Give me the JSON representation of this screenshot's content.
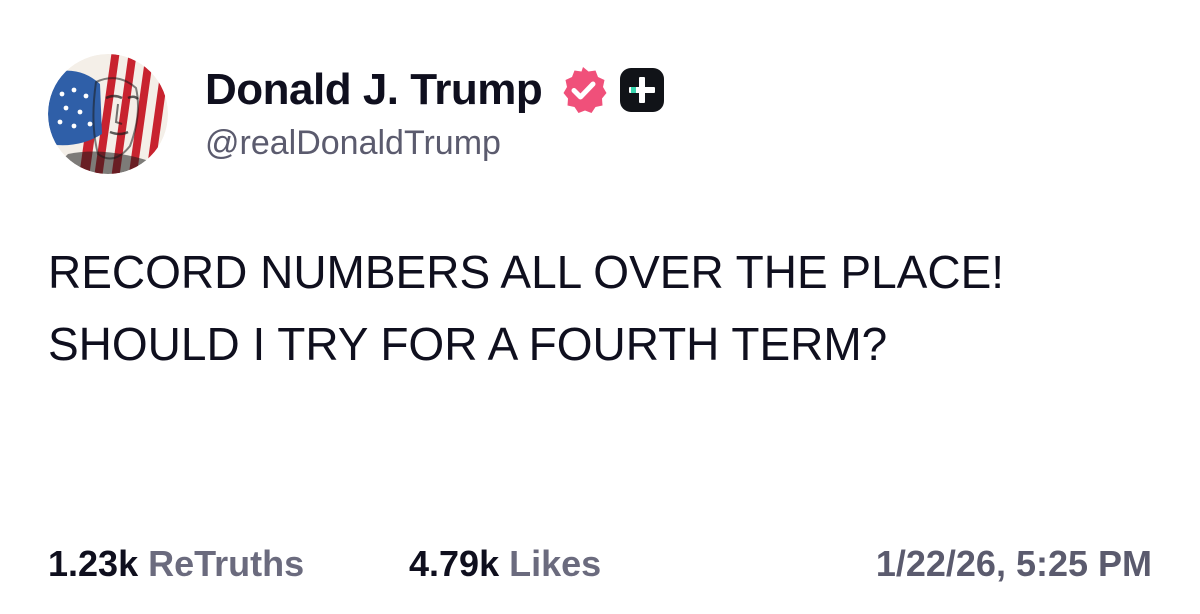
{
  "post": {
    "author": {
      "display_name": "Donald J. Trump",
      "handle": "@realDonaldTrump",
      "verified": true,
      "avatar": "flag-portrait-avatar"
    },
    "body": "RECORD NUMBERS ALL OVER THE PLACE! SHOULD I TRY FOR A FOURTH TERM?",
    "stats": {
      "retruths_count": "1.23k",
      "retruths_label": "ReTruths",
      "likes_count": "4.79k",
      "likes_label": "Likes"
    },
    "timestamp": "1/22/26, 5:25 PM"
  },
  "icons": {
    "verified": "verified-badge-icon",
    "plus": "truth-plus-icon"
  },
  "colors": {
    "text": "#0f0f1e",
    "secondary": "#5b5b6e",
    "verified": "#f0507a",
    "plus_badge_bg": "#111318",
    "plus_accent": "#3ad6b0"
  }
}
